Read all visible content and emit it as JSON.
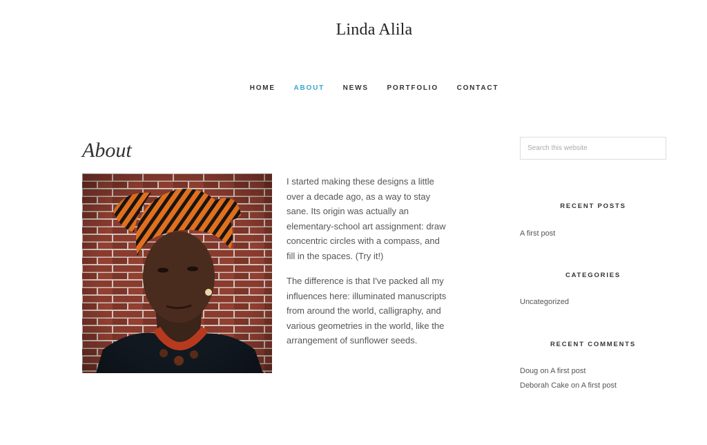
{
  "site": {
    "title": "Linda Alila"
  },
  "nav": {
    "items": [
      {
        "label": "HOME",
        "active": false
      },
      {
        "label": "ABOUT",
        "active": true
      },
      {
        "label": "NEWS",
        "active": false
      },
      {
        "label": "PORTFOLIO",
        "active": false
      },
      {
        "label": "CONTACT",
        "active": false
      }
    ]
  },
  "entry": {
    "title": "About",
    "paragraphs": [
      "I started making these designs a little over a decade ago, as a way to stay sane. Its origin was actually an elementary-school art assignment: draw concentric circles with a compass, and fill in the spaces. (Try it!)",
      "The difference is that I've packed all my influences here: illuminated manuscripts from around the world, calligraphy, and various geometries in the world, like the arrangement of sunflower seeds."
    ]
  },
  "sidebar": {
    "search_placeholder": "Search this website",
    "recent_posts": {
      "title": "RECENT POSTS",
      "items": [
        "A first post"
      ]
    },
    "categories": {
      "title": "CATEGORIES",
      "items": [
        "Uncategorized"
      ]
    },
    "recent_comments": {
      "title": "RECENT COMMENTS",
      "items": [
        {
          "author": "Doug",
          "connector": "on",
          "post": "A first post"
        },
        {
          "author": "Deborah Cake",
          "connector": "on",
          "post": "A first post"
        }
      ]
    }
  },
  "colors": {
    "accent": "#3aa5d3",
    "brick": "#8a3b2e",
    "text": "#555555"
  }
}
